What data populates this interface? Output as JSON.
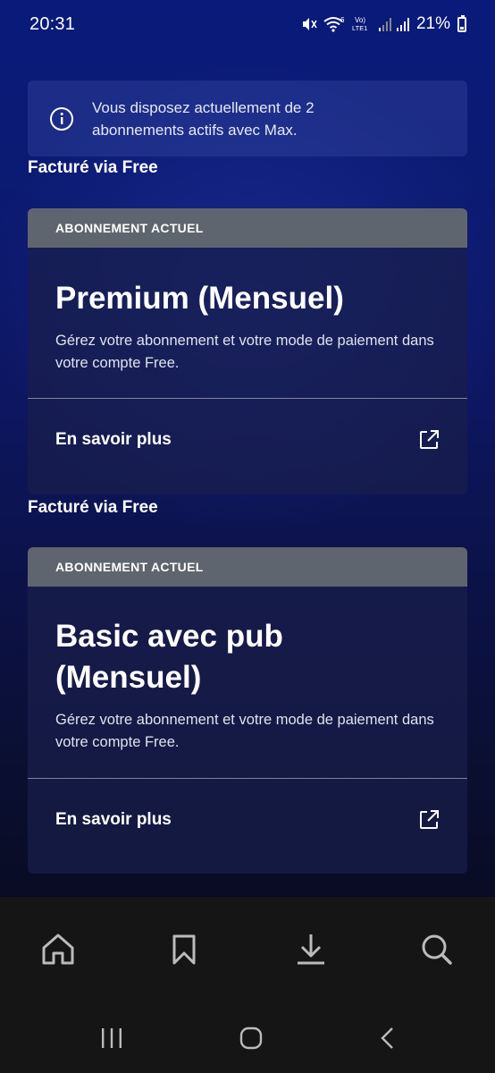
{
  "status_bar": {
    "time": "20:31",
    "battery": "21%",
    "icons": [
      "mute-icon",
      "wifi-6-icon",
      "volte-icon",
      "signal-icon",
      "signal-icon",
      "battery-icon"
    ]
  },
  "info_banner": {
    "icon": "info-icon",
    "text": "Vous disposez actuellement de 2 abonnements actifs avec Max."
  },
  "subscriptions": [
    {
      "billed_via": "Facturé via Free",
      "header": "ABONNEMENT ACTUEL",
      "plan": "Premium (Mensuel)",
      "description": "Gérez votre abonnement et votre mode de paiement dans votre compte Free.",
      "link": "En savoir plus"
    },
    {
      "billed_via": "Facturé via Free",
      "header": "ABONNEMENT ACTUEL",
      "plan": "Basic avec pub (Mensuel)",
      "description": "Gérez votre abonnement et votre mode de paiement dans votre compte Free.",
      "link": "En savoir plus"
    }
  ],
  "bottom_nav": [
    "home-icon",
    "bookmark-icon",
    "download-icon",
    "search-icon"
  ],
  "system_nav": [
    "recents-icon",
    "home-circle-icon",
    "back-icon"
  ]
}
